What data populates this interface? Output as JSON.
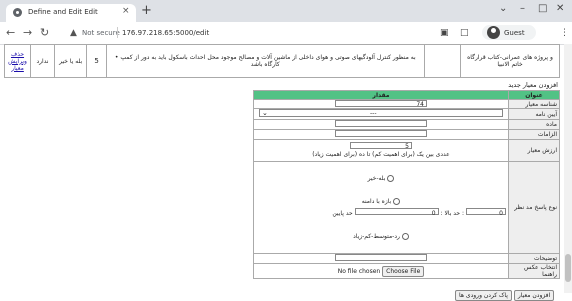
{
  "browser": {
    "tab_title": "Define and Edit Edit",
    "tab_close": "×",
    "new_tab": "+",
    "not_secure": "Not secure",
    "url": "176.97.218.65:5000/edit",
    "guest": "Guest",
    "win_min": "–",
    "win_max": "□",
    "win_close": "✕",
    "win_chevron": "⌄"
  },
  "criteria_row": {
    "edit_link": "ویرایش معیار",
    "delete_link": "حذف",
    "value_5": "5",
    "yes_no": "بله یا خیر",
    "none": "ندارد",
    "description": "• به منظور کنترل آلودگیهای صوتی و هوای داخلی از ماشین آلات و مصالح موجود محل احداث باسکول باید به دور از کمپ کارگاه باشد",
    "title": "و پروژه های عمرانی-کتاب قرارگاه خاتم الانبیا"
  },
  "add_caption": "افزودن معیار جدید",
  "edit_table": {
    "col_title": "عنوان",
    "col_value": "مقدار",
    "rows": {
      "id_label": "شناسه معیار",
      "id_value": "74",
      "regulation_label": "آیین نامه",
      "regulation_value": "---",
      "article_label": "ماده",
      "requirements_label": "الزامات",
      "weight_label": "ارزش معیار",
      "weight_value": "5",
      "weight_hint": "عددی بین یک (برای اهمیت کم) تا ده (برای اهمیت زیاد)",
      "response_label": "نوع پاسخ مد نظر",
      "opt_yes_no": "بله-خیر",
      "opt_range": "بازه با دامنه",
      "upper_limit_label": "حد بالا :",
      "upper_limit_value": "0",
      "lower_limit_label": "حد پایین :",
      "lower_limit_value": "0",
      "opt_levels": "رد-متوسط-کم-زیاد",
      "explanations_label": "توضیحات",
      "image_label": "انتخاب عکس راهنما",
      "choose_file": "Choose File",
      "no_file": "No file chosen"
    }
  },
  "buttons": {
    "add_criterion": "افزودن معیار",
    "clear_inputs": "پاک کردن ورودی ها"
  }
}
